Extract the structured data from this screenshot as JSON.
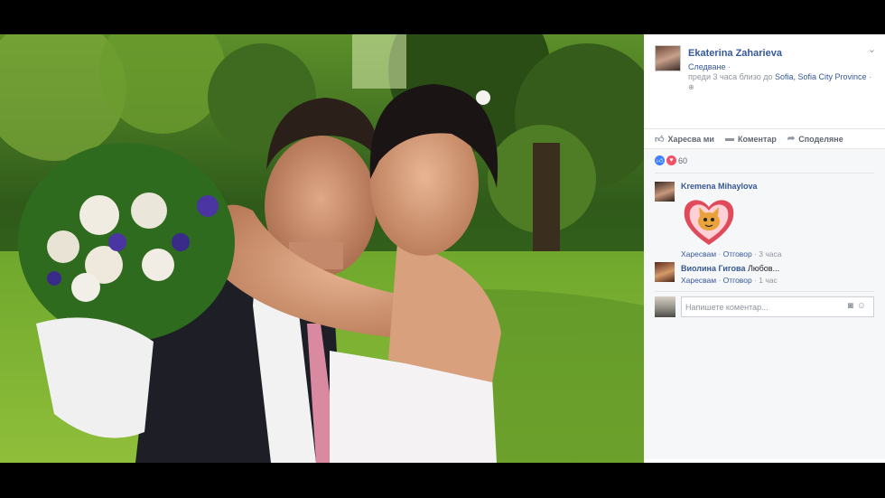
{
  "post": {
    "author": "Ekaterina Zaharieva",
    "follow_label": "Следване",
    "time": "преди 3 часа близо до",
    "location": "Sofia, Sofia City Province",
    "privacy_icon": "globe-icon",
    "menu_icon": "chevron-down-icon"
  },
  "actions": {
    "like": "Харесва ми",
    "comment": "Коментар",
    "share": "Споделяне"
  },
  "reactions": {
    "count": "60",
    "types": [
      "like",
      "love"
    ],
    "colors": {
      "like": "#4080ff",
      "love": "#f25268"
    }
  },
  "comments": [
    {
      "author": "Kremena Mihaylova",
      "text": "",
      "sticker": "heart-cat-sticker",
      "like_label": "Харесвам",
      "reply_label": "Отговор",
      "time": "3 часа"
    },
    {
      "author": "Виолина Гигова",
      "text": "Любов...",
      "like_label": "Харесвам",
      "reply_label": "Отговор",
      "time": "1 час"
    }
  ],
  "composer": {
    "placeholder": "Напишете коментар..."
  },
  "colors": {
    "link": "#365899",
    "muted": "#90949c",
    "panel_bg": "#f6f7f9"
  }
}
